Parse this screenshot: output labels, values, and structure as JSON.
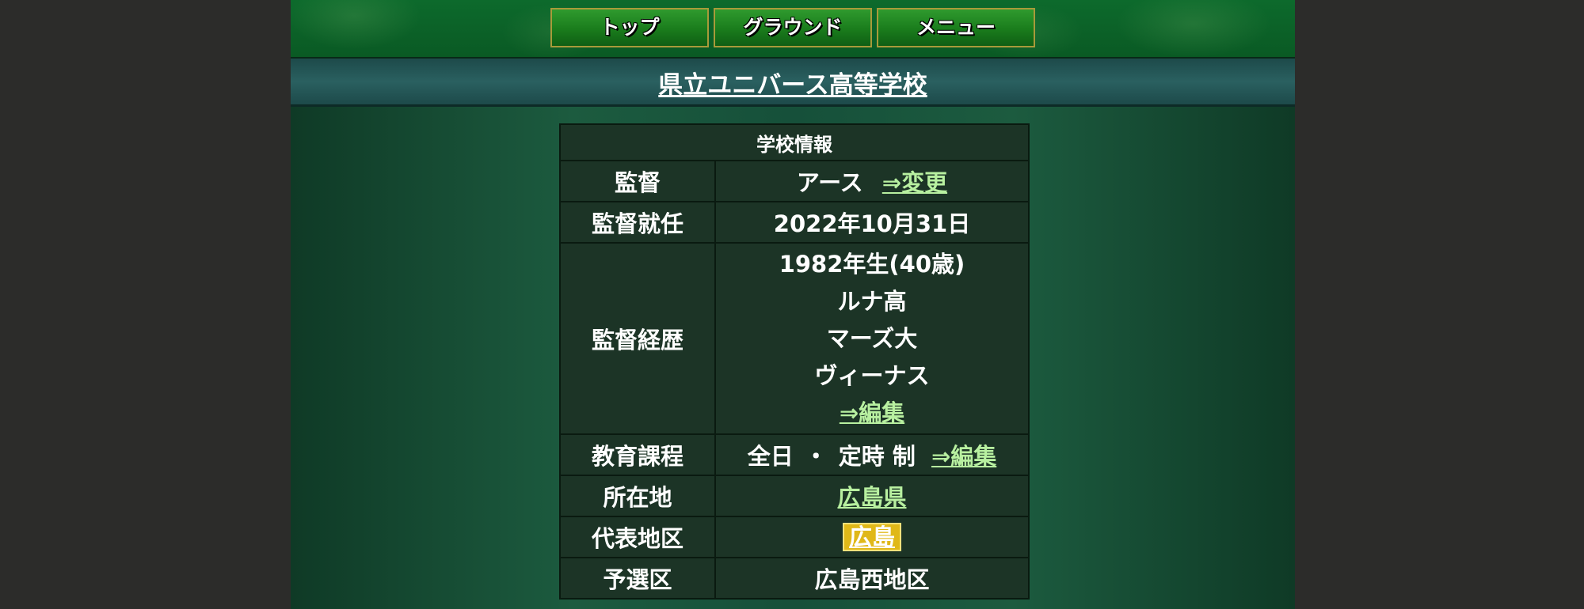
{
  "nav": {
    "top": "トップ",
    "ground": "グラウンド",
    "menu": "メニュー"
  },
  "school": {
    "name": "県立ユニバース高等学校"
  },
  "info": {
    "header": "学校情報",
    "manager_label": "監督",
    "manager_name": "アース",
    "change_link": "⇒変更",
    "appointed_label": "監督就任",
    "appointed_date": "2022年10月31日",
    "career_label": "監督経歴",
    "career_lines": [
      "1982年生(40歳)",
      "ルナ高",
      "マーズ大",
      "ヴィーナス"
    ],
    "edit_link": "⇒編集",
    "curriculum_label": "教育課程",
    "curriculum_full": "全日",
    "curriculum_dot": "・",
    "curriculum_part": "定時 制",
    "location_label": "所在地",
    "location_value": "広島県",
    "district_label": "代表地区",
    "district_value": "広島",
    "prelim_label": "予選区",
    "prelim_value": "広島西地区"
  },
  "colors": {
    "link": "#b8f0a0",
    "badge": "#e0b818",
    "button_border": "#a89a3a"
  }
}
